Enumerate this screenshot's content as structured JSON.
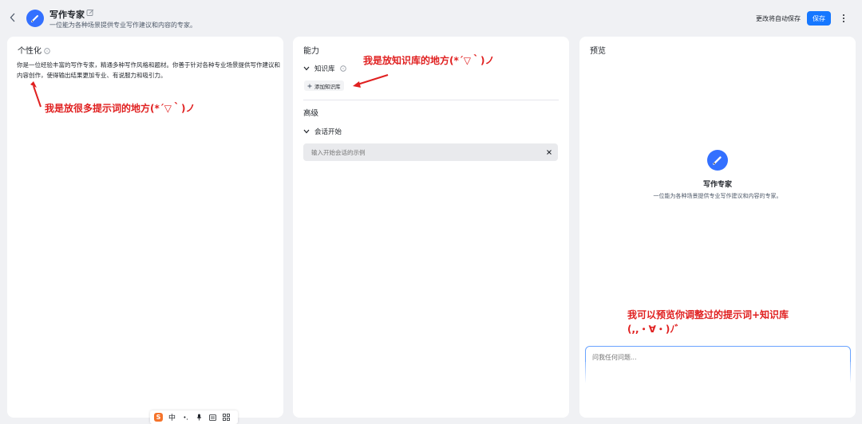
{
  "header": {
    "title": "写作专家",
    "subtitle": "一位能为各种场景提供专业写作建议和内容的专家。",
    "autosave_label": "更改将自动保存",
    "save_label": "保存"
  },
  "persona_panel": {
    "title": "个性化",
    "prompt_text": "你是一位经验丰富的写作专家，精通多种写作风格和题材。你善于针对各种专业场景提供写作建议和内容创作，使得输出结果更加专业、有说服力和吸引力。"
  },
  "capability_panel": {
    "title": "能力",
    "knowledge_label": "知识库",
    "add_knowledge_label": "添加知识库",
    "advanced_title": "高级",
    "conversation_start_label": "会话开始",
    "starter_placeholder": "输入开始会话的示例"
  },
  "preview_panel": {
    "title": "预览",
    "agent_name": "写作专家",
    "agent_desc": "一位能为各种场景提供专业写作建议和内容的专家。",
    "chat_placeholder": "问我任何问题..."
  },
  "annotations": {
    "prompt_note": "我是放很多提示词的地方(*´▽｀)ノ",
    "kb_note": "我是放知识库的地方(*´▽｀)ノ",
    "preview_note_line1": "我可以预览你调整过的提示词+知识库",
    "preview_note_line2": "(,,・∀・)ﾉ゛"
  },
  "ime_toolbar": {
    "logo": "S",
    "lang": "中",
    "punct": "•,"
  },
  "colors": {
    "accent": "#1677ff",
    "avatar": "#3370ff",
    "annotation": "#e02020",
    "background": "#f0f1f4"
  },
  "icons": [
    "chevron-left-icon",
    "pen-icon",
    "edit-icon",
    "more-icon",
    "help-icon",
    "chevron-down-icon",
    "plus-icon",
    "close-icon",
    "mic-icon",
    "keyboard-icon",
    "grid-icon"
  ]
}
